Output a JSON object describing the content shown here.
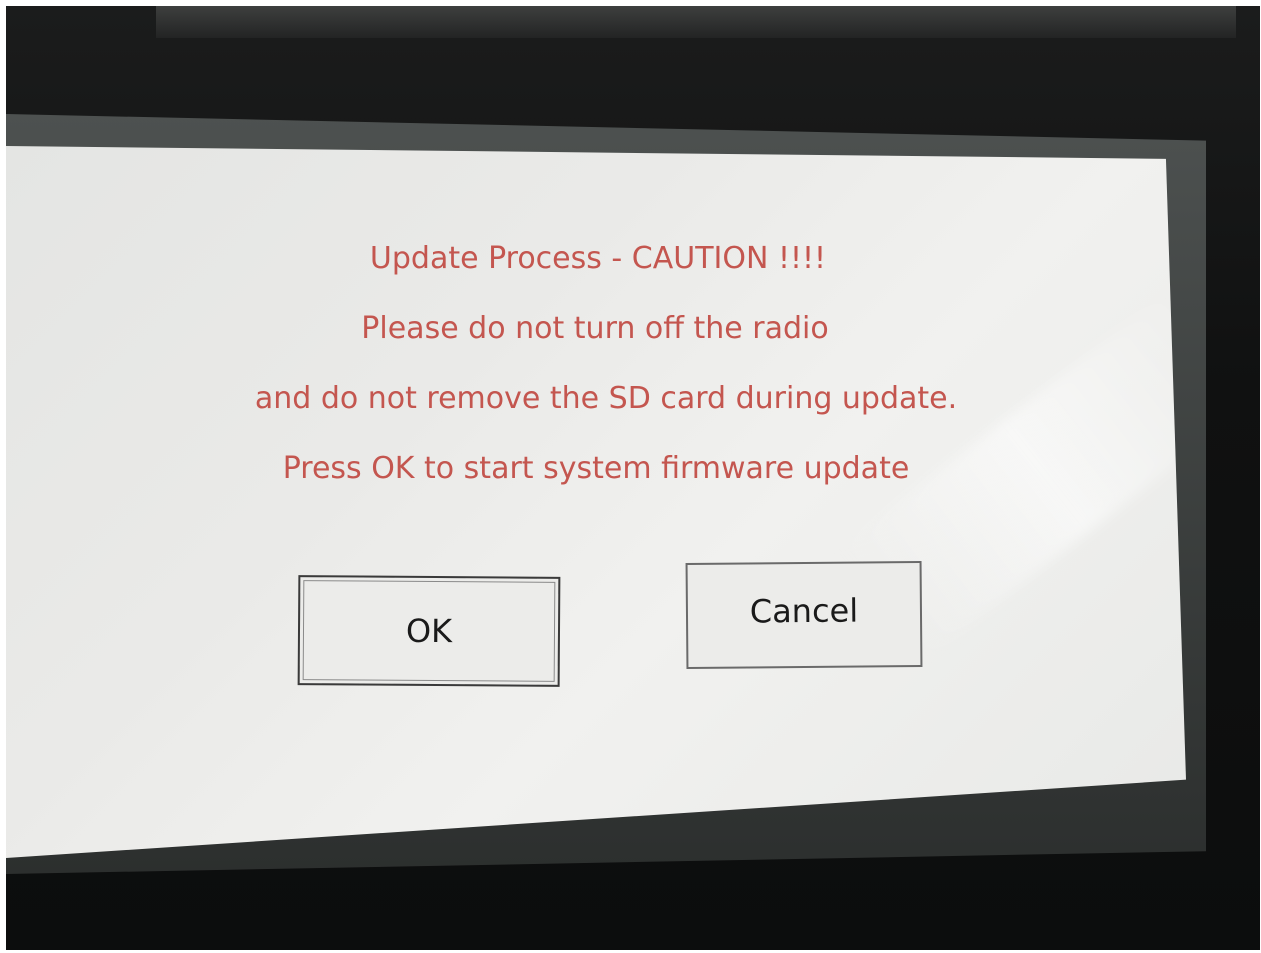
{
  "dialog": {
    "title": "Update Process - CAUTION !!!!",
    "message_lines": [
      "Please do not turn off the radio",
      "and do not remove the SD card during update.",
      "Press OK to start system firmware update"
    ],
    "ok_label": "OK",
    "cancel_label": "Cancel",
    "colors": {
      "message_text": "#c4564f",
      "screen_background": "#ebebe9",
      "button_text": "#1a1a1a"
    }
  }
}
